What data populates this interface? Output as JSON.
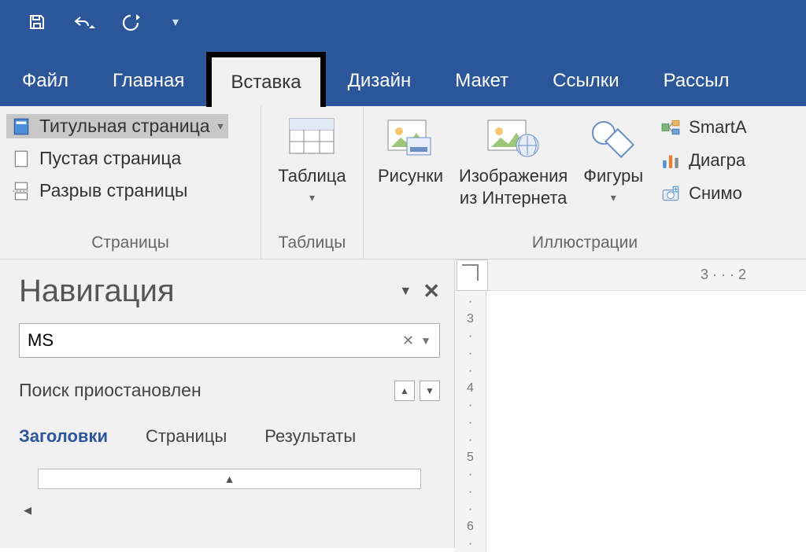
{
  "qat": {
    "save": "save-icon",
    "undo": "undo-icon",
    "redo": "redo-icon"
  },
  "tabs": {
    "file": "Файл",
    "home": "Главная",
    "insert": "Вставка",
    "design": "Дизайн",
    "layout": "Макет",
    "references": "Ссылки",
    "mailings": "Рассыл"
  },
  "ribbon": {
    "pages": {
      "cover_page": "Титульная страница",
      "blank_page": "Пустая страница",
      "page_break": "Разрыв страницы",
      "group_label": "Страницы"
    },
    "tables": {
      "table": "Таблица",
      "group_label": "Таблицы"
    },
    "illustrations": {
      "pictures": "Рисунки",
      "online_pictures_l1": "Изображения",
      "online_pictures_l2": "из Интернета",
      "shapes": "Фигуры",
      "smartart": "SmartA",
      "chart": "Диагра",
      "screenshot": "Снимо",
      "group_label": "Иллюстрации"
    }
  },
  "nav": {
    "title": "Навигация",
    "search_value": "MS",
    "status": "Поиск приостановлен",
    "tabs": {
      "headings": "Заголовки",
      "pages": "Страницы",
      "results": "Результаты"
    }
  },
  "ruler": {
    "h": "3 · · · 2",
    "v": [
      "·",
      "3",
      "·",
      "·",
      "·",
      "4",
      "·",
      "·",
      "·",
      "5",
      "·",
      "·",
      "·",
      "6",
      "·"
    ]
  }
}
